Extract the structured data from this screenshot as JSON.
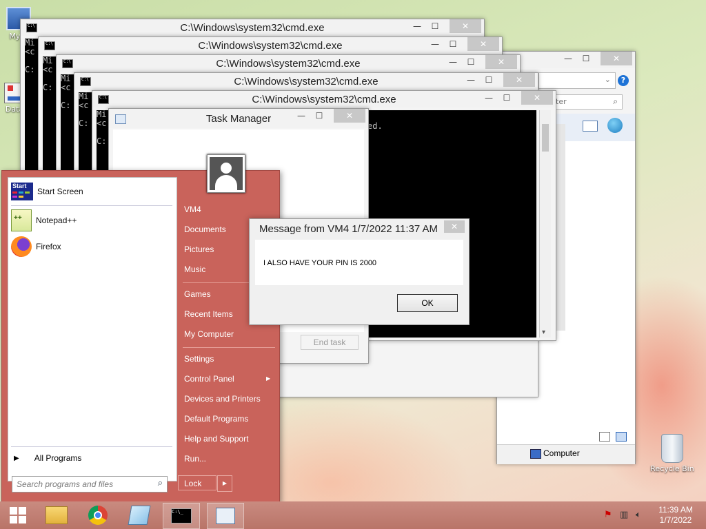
{
  "desktop": {
    "icons": [
      {
        "label": "My C",
        "icon": "computer-icon"
      },
      {
        "label": "Data",
        "icon": "shortcut-icon"
      },
      {
        "label": "Recycle Bin",
        "icon": "recycle-bin-icon"
      }
    ]
  },
  "cmd_windows": [
    {
      "title": "C:\\Windows\\system32\\cmd.exe",
      "prefix": "Mi\n<c\n\nC:"
    },
    {
      "title": "C:\\Windows\\system32\\cmd.exe",
      "prefix": "Mi\n<c\n\nC:"
    },
    {
      "title": "C:\\Windows\\system32\\cmd.exe",
      "prefix": "Mi\n<c\n\nC:"
    },
    {
      "title": "C:\\Windows\\system32\\cmd.exe",
      "prefix": "Mi\n<c\n\nC:"
    },
    {
      "title": "C:\\Windows\\system32\\cmd.exe",
      "prefix": "Mi\n<c\n\nC:",
      "tail": "ed."
    }
  ],
  "explorer": {
    "search_placeholder": "ter",
    "status_computer": "Computer"
  },
  "task_manager": {
    "title": "Task Manager",
    "end_task": "End task"
  },
  "start_menu": {
    "programs": [
      {
        "label": "Start Screen",
        "icon": "start-screen-icon"
      },
      {
        "label": "Notepad++",
        "icon": "notepad-plus-plus-icon"
      },
      {
        "label": "Firefox",
        "icon": "firefox-icon"
      }
    ],
    "all_programs": "All Programs",
    "search_placeholder": "Search programs and files",
    "start_tile_text": "Start",
    "right_items": [
      "VM4",
      "Documents",
      "Pictures",
      "Music",
      "Games",
      "Recent Items",
      "My Computer",
      "Settings",
      "Control Panel",
      "Devices and Printers",
      "Default Programs",
      "Help and Support",
      "Run..."
    ],
    "lock_label": "Lock"
  },
  "message_box": {
    "title": "Message from VM4 1/7/2022 11:37 AM",
    "message": "I ALSO HAVE YOUR PIN IS 2000",
    "ok_label": "OK"
  },
  "taskbar": {
    "time": "11:39 AM",
    "date": "1/7/2022",
    "buttons": [
      "start-button-icon",
      "file-explorer-icon",
      "chrome-icon",
      "notepad-icon",
      "cmd-icon",
      "task-manager-icon"
    ]
  },
  "colors": {
    "start_menu": "#c9635b",
    "taskbar": "#c08176",
    "console": "#000000"
  }
}
